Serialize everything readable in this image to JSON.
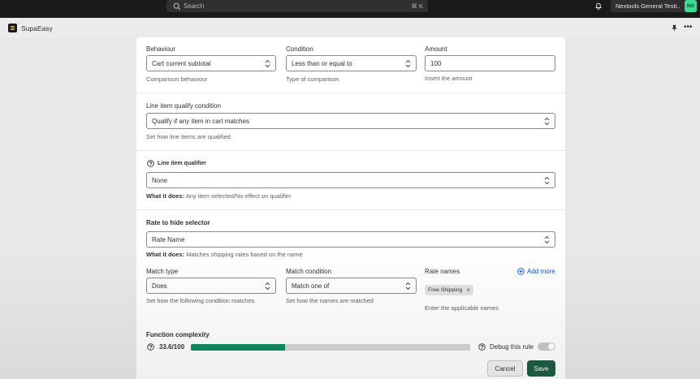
{
  "topbar": {
    "search_label": "Search",
    "search_shortcut": "⌘ K",
    "store_name": "Nextools General Testi...",
    "store_initials": "NS"
  },
  "app": {
    "name": "SupaEasy"
  },
  "behaviour": {
    "behaviour_label": "Behaviour",
    "behaviour_value": "Cart current subtotal",
    "behaviour_help": "Comparison behaviour",
    "condition_label": "Condition",
    "condition_value": "Less than or equal to",
    "condition_help": "Type of comparison",
    "amount_label": "Amount",
    "amount_value": "100",
    "amount_help": "Insert the amount"
  },
  "line_item": {
    "label": "Line item qualify condition",
    "value": "Qualify if any item in cart matches",
    "help": "Set how line items are qualified"
  },
  "qualifier": {
    "label": "Line item qualifier",
    "value": "None",
    "help_prefix": "What it does:",
    "help_text": "Any item selected/No effect on qualifier"
  },
  "rate": {
    "heading": "Rate to hide selector",
    "value": "Rate Name",
    "help_prefix": "What it does:",
    "help_text": "Matches shipping rates based on the name",
    "match_type_label": "Match type",
    "match_type_value": "Does",
    "match_type_help": "Set how the following condition matches",
    "match_condition_label": "Match condition",
    "match_condition_value": "Match one of",
    "match_condition_help": "Set how the names are matched",
    "rate_names_label": "Rate names",
    "add_more": "Add more",
    "tag": "Free Shipping",
    "rate_names_help": "Enter the applicable names"
  },
  "complexity": {
    "label": "Function complexity",
    "value_text": "33.6/100",
    "value": 33.6,
    "max": 100,
    "debug_label": "Debug this rule",
    "debug_enabled": false
  },
  "actions": {
    "cancel": "Cancel",
    "save": "Save"
  },
  "colors": {
    "accent": "#0f8a5f",
    "save_button": "#1f5d44",
    "link": "#005bd3",
    "avatar": "#3ddc91"
  }
}
